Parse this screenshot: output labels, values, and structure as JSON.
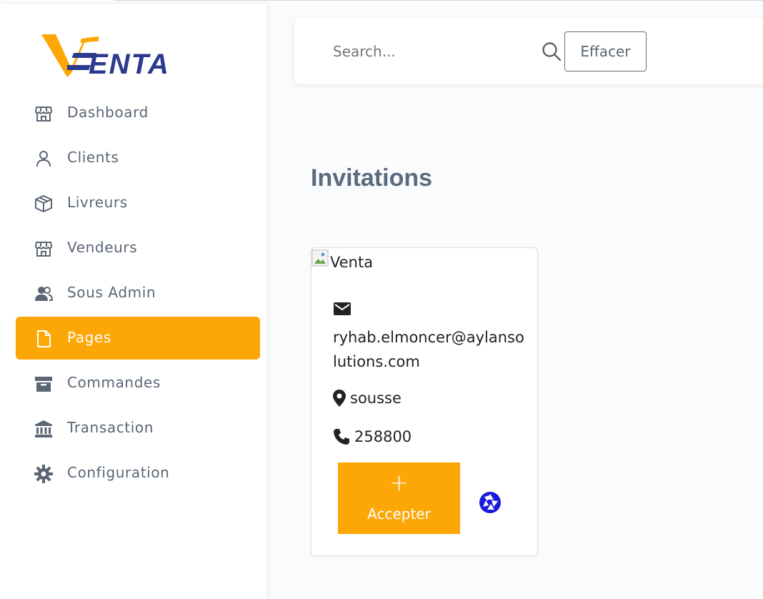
{
  "brand": {
    "logo_text": "ENTA",
    "logo_initial": "V",
    "accent": "#fda706",
    "primary": "#2b3a8f"
  },
  "sidebar": {
    "items": [
      {
        "label": "Dashboard",
        "icon": "store-icon"
      },
      {
        "label": "Clients",
        "icon": "user-icon"
      },
      {
        "label": "Livreurs",
        "icon": "box-icon"
      },
      {
        "label": "Vendeurs",
        "icon": "store-icon"
      },
      {
        "label": "Sous Admin",
        "icon": "users-icon"
      },
      {
        "label": "Pages",
        "icon": "file-icon",
        "active": true
      },
      {
        "label": "Commandes",
        "icon": "archive-icon"
      },
      {
        "label": "Transaction",
        "icon": "bank-icon"
      },
      {
        "label": "Configuration",
        "icon": "gear-icon"
      }
    ]
  },
  "header": {
    "search_placeholder": "Search...",
    "clear_label": "Effacer"
  },
  "main": {
    "title": "Invitations",
    "card": {
      "image_alt": "Venta",
      "email": "ryhab.elmoncer@aylansolutions.com",
      "location": "sousse",
      "phone": "258800",
      "accept_icon": "+",
      "accept_label": "Accepter",
      "decline_icon": "aperture-icon"
    }
  }
}
